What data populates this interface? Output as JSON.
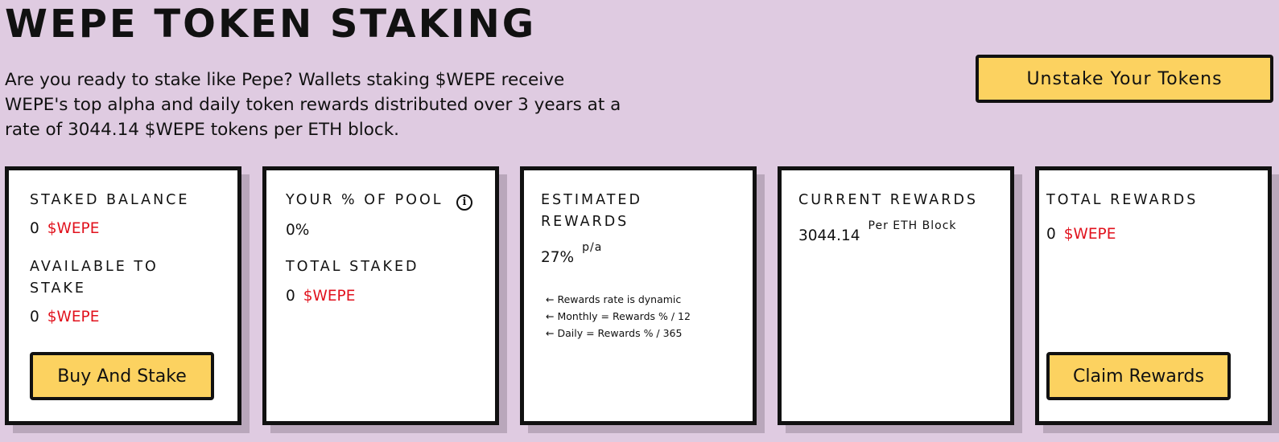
{
  "page": {
    "title": "WEPE TOKEN STAKING",
    "intro": "Are you ready to stake like Pepe? Wallets staking $WEPE receive WEPE's top alpha and daily token rewards distributed over 3 years at a rate of 3044.14 $WEPE tokens per ETH block.",
    "unstake_button": "Unstake Your Tokens"
  },
  "theme": {
    "background": "#dfcbe1",
    "button_fill": "#fcd260",
    "token_red": "#e1121d",
    "card_shadow": "#b9a7bb"
  },
  "cards": {
    "staked": {
      "label": "STAKED BALANCE",
      "value": "0",
      "unit": "$WEPE",
      "available_label": "AVAILABLE TO STAKE",
      "available_value": "0",
      "available_unit": "$WEPE",
      "button": "Buy And Stake"
    },
    "pool": {
      "label": "YOUR % OF POOL",
      "info_icon": "info-icon",
      "value": "0%",
      "total_label": "TOTAL STAKED",
      "total_value": "0",
      "total_unit": "$WEPE"
    },
    "estimated": {
      "label": "ESTIMATED REWARDS",
      "value": "27%",
      "suffix": "p/a",
      "notes": [
        "Rewards rate is dynamic",
        "Monthly = Rewards % / 12",
        "Daily = Rewards % / 365"
      ],
      "note_arrow": "←"
    },
    "current": {
      "label": "CURRENT REWARDS",
      "value": "3044.14",
      "suffix": "Per ETH Block"
    },
    "total": {
      "label": "TOTAL REWARDS",
      "value": "0",
      "unit": "$WEPE",
      "button": "Claim Rewards"
    }
  }
}
